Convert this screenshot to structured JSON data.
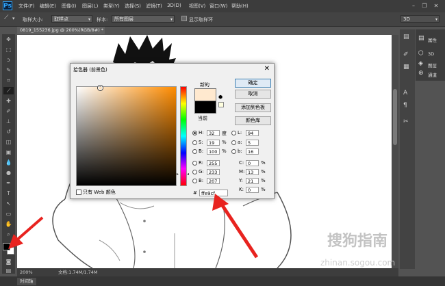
{
  "app": {
    "logo": "Ps"
  },
  "menu": [
    "文件(F)",
    "编辑(E)",
    "图像(I)",
    "图层(L)",
    "类型(Y)",
    "选择(S)",
    "滤镜(T)",
    "3D(D)",
    "视图(V)",
    "窗口(W)",
    "帮助(H)"
  ],
  "options": {
    "sample_size_label": "取样大小:",
    "sample_size_value": "取样点",
    "sample_label": "样本:",
    "sample_value": "所有图层",
    "show_ring_label": "显示取样环",
    "workspace_value": "3D"
  },
  "document": {
    "tab_title": "0819_155236.jpg @ 200%(RGB/8#) *",
    "zoom": "200%",
    "doc_info": "文档:1.74M/1.74M"
  },
  "timeline_tab": "时间轴",
  "right_panel": {
    "items": [
      {
        "label": "属性",
        "icon": "properties-icon"
      },
      {
        "label": "3D",
        "icon": "3d-icon"
      },
      {
        "label": "图层",
        "icon": "layers-icon"
      },
      {
        "label": "通道",
        "icon": "channels-icon"
      }
    ]
  },
  "dialog": {
    "title": "拾色器 (前景色)",
    "new_label": "新的",
    "current_label": "当前",
    "buttons": {
      "ok": "确定",
      "cancel": "取消",
      "add_swatch": "添加到色板",
      "color_library": "颜色库"
    },
    "web_only_label": "只有 Web 颜色",
    "hex_label": "#",
    "hex_value": "ffe9cf",
    "new_color": "#ffe9cf",
    "current_color": "#000000",
    "hsb": {
      "H": {
        "label": "H:",
        "value": "32",
        "unit": "度"
      },
      "S": {
        "label": "S:",
        "value": "19",
        "unit": "%"
      },
      "B": {
        "label": "B:",
        "value": "100",
        "unit": "%"
      }
    },
    "rgb": {
      "R": {
        "label": "R:",
        "value": "255"
      },
      "G": {
        "label": "G:",
        "value": "233"
      },
      "B": {
        "label": "B:",
        "value": "207"
      }
    },
    "lab": {
      "L": {
        "label": "L:",
        "value": "94"
      },
      "a": {
        "label": "a:",
        "value": "5"
      },
      "b": {
        "label": "b:",
        "value": "16"
      }
    },
    "cmyk": {
      "C": {
        "label": "C:",
        "value": "0",
        "unit": "%"
      },
      "M": {
        "label": "M:",
        "value": "13",
        "unit": "%"
      },
      "Y": {
        "label": "Y:",
        "value": "21",
        "unit": "%"
      },
      "K": {
        "label": "K:",
        "value": "0",
        "unit": "%"
      }
    }
  },
  "watermark": {
    "text": "搜狗指南",
    "url": "zhinan.sogou.com"
  },
  "colors": {
    "accent_arrow": "#e8231f",
    "foreground": "#000000",
    "background": "#ffffff"
  }
}
